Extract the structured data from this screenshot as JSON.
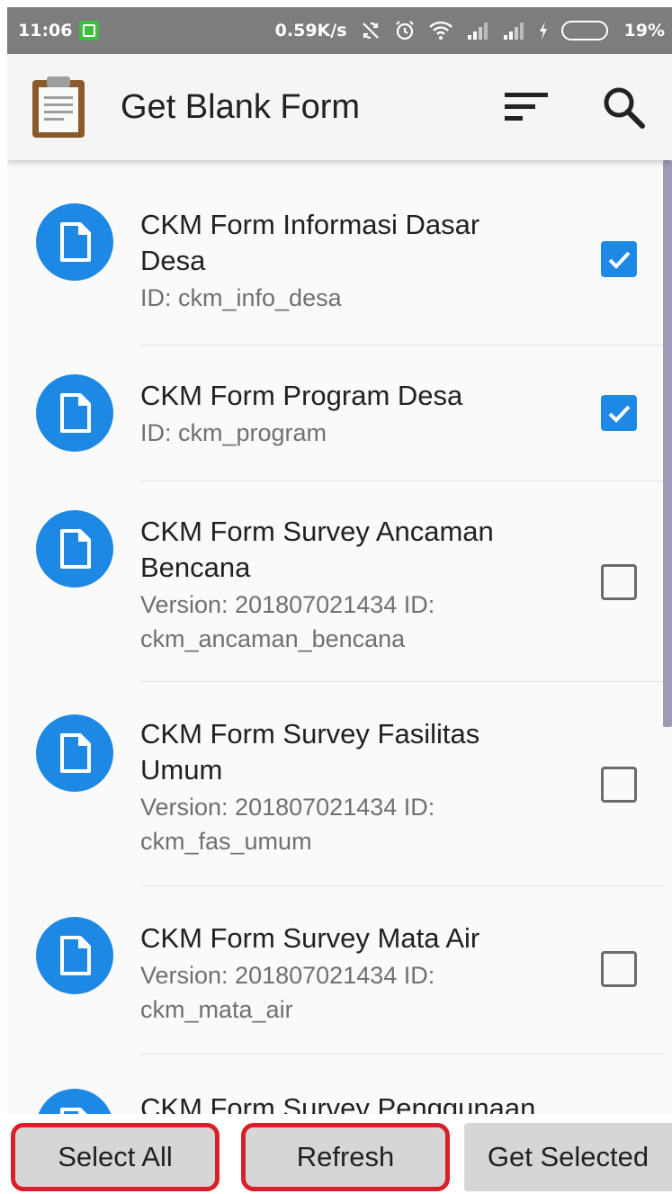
{
  "status_bar": {
    "time": "11:06",
    "speed": "0.59K/s",
    "battery": "19%",
    "icons": [
      "notification-icon",
      "sync-off-icon",
      "alarm-icon",
      "wifi-icon",
      "signal-icon",
      "signal-icon-2",
      "charging-icon",
      "battery-icon"
    ]
  },
  "app_bar": {
    "title": "Get Blank Form",
    "actions": [
      "sort-icon",
      "search-icon"
    ]
  },
  "forms": [
    {
      "title_lines": [
        "CKM Form Informasi Dasar",
        "Desa"
      ],
      "subtitle_lines": [
        "ID: ckm_info_desa"
      ],
      "checked": true
    },
    {
      "title_lines": [
        "CKM Form Program Desa"
      ],
      "subtitle_lines": [
        "ID: ckm_program"
      ],
      "checked": true
    },
    {
      "title_lines": [
        "CKM Form Survey Ancaman",
        "Bencana"
      ],
      "subtitle_lines": [
        "Version: 201807021434 ID:",
        "ckm_ancaman_bencana"
      ],
      "checked": false
    },
    {
      "title_lines": [
        "CKM Form Survey Fasilitas",
        "Umum"
      ],
      "subtitle_lines": [
        "Version: 201807021434 ID:",
        "ckm_fas_umum"
      ],
      "checked": false
    },
    {
      "title_lines": [
        "CKM Form Survey Mata Air"
      ],
      "subtitle_lines": [
        "Version: 201807021434 ID:",
        "ckm_mata_air"
      ],
      "checked": false
    },
    {
      "title_lines": [
        "CKM Form Survey Penggunaan"
      ],
      "subtitle_lines": [],
      "checked": false
    }
  ],
  "buttons": {
    "select_all": "Select All",
    "refresh": "Refresh",
    "get_selected": "Get Selected"
  },
  "colors": {
    "accent": "#1e88e5",
    "highlight": "#d8202a"
  }
}
